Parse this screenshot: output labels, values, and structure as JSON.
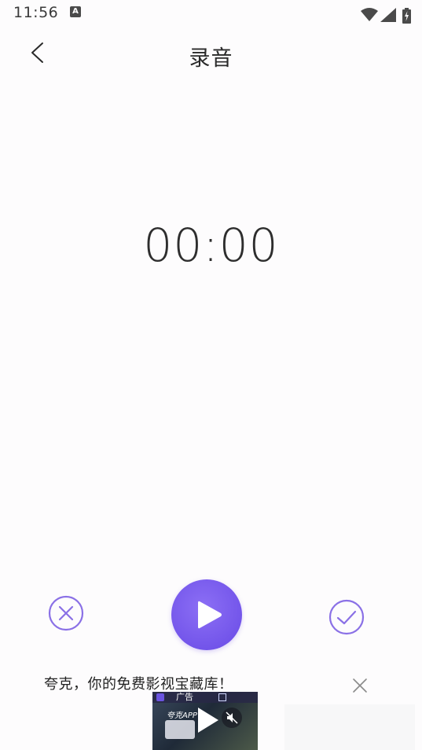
{
  "status_bar": {
    "time": "11:56",
    "notification_glyph": "A",
    "icons": [
      "wifi-icon",
      "signal-icon",
      "battery-charging-icon"
    ]
  },
  "header": {
    "title": "录音",
    "back_icon": "chevron-left-icon"
  },
  "timer": {
    "value": "00:00"
  },
  "controls": {
    "cancel_icon": "circle-x-icon",
    "play_icon": "play-icon",
    "confirm_icon": "circle-check-icon"
  },
  "ad": {
    "headline": "夸克，你的免费影视宝藏库！",
    "tag": "广告",
    "brand": "夸克APP",
    "close_icon": "close-icon",
    "mute_icon": "mute-icon"
  },
  "colors": {
    "accent": "#7355ea",
    "accent_outline": "#8a70e6",
    "background": "#fdfcfd",
    "text": "#2a2a2a"
  }
}
